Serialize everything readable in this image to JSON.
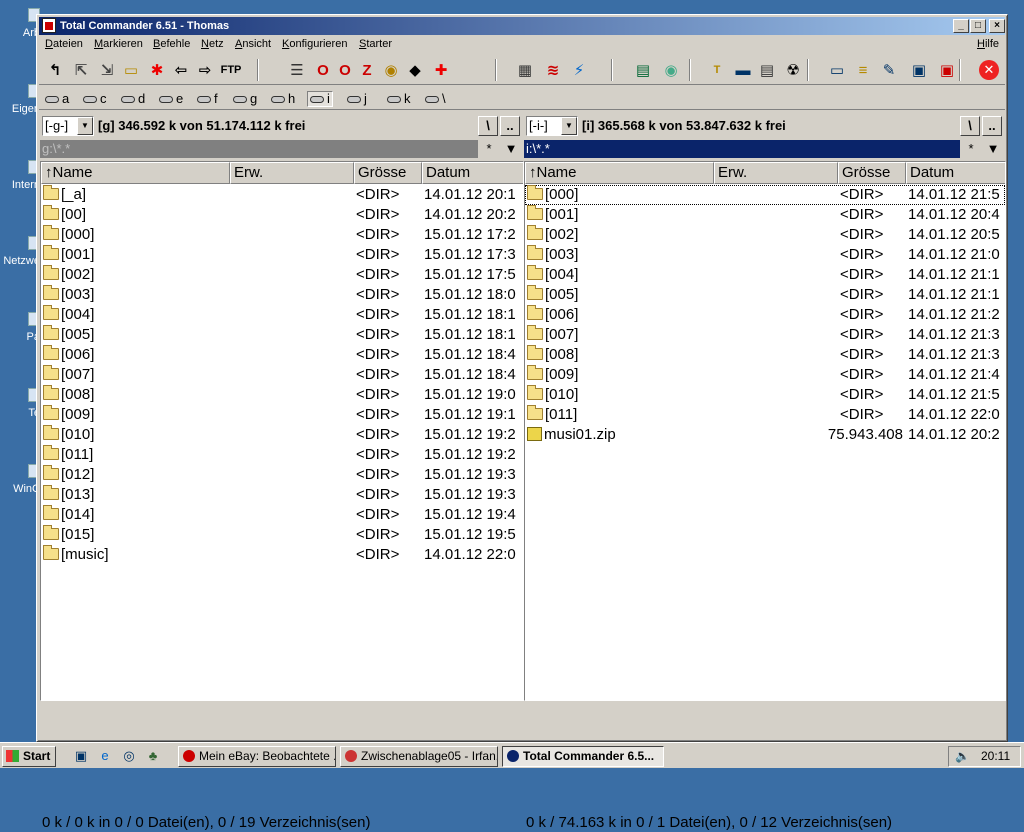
{
  "desktop": {
    "icons": [
      {
        "label": "Arb"
      },
      {
        "label": "Eigen"
      },
      {
        "label": "Intern"
      },
      {
        "label": "Netzwe"
      },
      {
        "label": "Pa"
      },
      {
        "label": "Te"
      },
      {
        "label": "WinC"
      }
    ]
  },
  "window": {
    "title": "Total Commander 6.51 - Thomas",
    "controls": {
      "minimize": "_",
      "maximize": "□",
      "close": "×"
    }
  },
  "menu": {
    "items": [
      "Dateien",
      "Markieren",
      "Befehle",
      "Netz",
      "Ansicht",
      "Konfigurieren",
      "Starter"
    ],
    "help": "Hilfe"
  },
  "toolbar": {
    "buttons": [
      {
        "name": "refresh-icon",
        "glyph": "↰",
        "color": "#000"
      },
      {
        "name": "pack-icon",
        "glyph": "⇱",
        "color": "#444"
      },
      {
        "name": "unpack-icon",
        "glyph": "⇲",
        "color": "#444"
      },
      {
        "name": "new-folder-icon",
        "glyph": "▭",
        "color": "#b58a00"
      },
      {
        "name": "select-all-icon",
        "glyph": "✱",
        "color": "#e00"
      },
      {
        "name": "back-icon",
        "glyph": "⇦",
        "color": "#000"
      },
      {
        "name": "forward-icon",
        "glyph": "⇨",
        "color": "#000"
      },
      {
        "name": "ftp-icon",
        "glyph": "FTP",
        "color": "#000"
      },
      {
        "name": "list-icon",
        "glyph": "☰",
        "color": "#333"
      },
      {
        "name": "opera-icon",
        "glyph": "O",
        "color": "#c00"
      },
      {
        "name": "opera2-icon",
        "glyph": "O",
        "color": "#c00"
      },
      {
        "name": "z-icon",
        "glyph": "Z",
        "color": "#c00"
      },
      {
        "name": "uedit-icon",
        "glyph": "◉",
        "color": "#b08000"
      },
      {
        "name": "batman-icon",
        "glyph": "◆",
        "color": "#000"
      },
      {
        "name": "swiss-icon",
        "glyph": "✚",
        "color": "#e00"
      },
      {
        "name": "chip-icon",
        "glyph": "▦",
        "color": "#333"
      },
      {
        "name": "stripes-icon",
        "glyph": "≋",
        "color": "#c00"
      },
      {
        "name": "lightning-icon",
        "glyph": "⚡",
        "color": "#06c"
      },
      {
        "name": "film-icon",
        "glyph": "▤",
        "color": "#063"
      },
      {
        "name": "eye-icon",
        "glyph": "◉",
        "color": "#4a8"
      },
      {
        "name": "tcp-icon",
        "glyph": "T",
        "color": "#b58a00"
      },
      {
        "name": "car-icon",
        "glyph": "▬",
        "color": "#036"
      },
      {
        "name": "notepad-icon",
        "glyph": "▤",
        "color": "#333"
      },
      {
        "name": "radiation-icon",
        "glyph": "☢",
        "color": "#000"
      },
      {
        "name": "computer-icon",
        "glyph": "▭",
        "color": "#036"
      },
      {
        "name": "tree-icon",
        "glyph": "≡",
        "color": "#b58a00"
      },
      {
        "name": "edit-icon",
        "glyph": "✎",
        "color": "#036"
      },
      {
        "name": "network-icon",
        "glyph": "▣",
        "color": "#036"
      },
      {
        "name": "monitor-icon",
        "glyph": "▣",
        "color": "#c00"
      },
      {
        "name": "exit-icon",
        "glyph": "✕",
        "color": "#fff"
      }
    ]
  },
  "drives": [
    {
      "letter": "a",
      "active": false
    },
    {
      "letter": "c",
      "active": false
    },
    {
      "letter": "d",
      "active": false
    },
    {
      "letter": "e",
      "active": false
    },
    {
      "letter": "f",
      "active": false
    },
    {
      "letter": "g",
      "active": false
    },
    {
      "letter": "h",
      "active": false
    },
    {
      "letter": "i",
      "active": true
    },
    {
      "letter": "j",
      "active": false
    },
    {
      "letter": "k",
      "active": false
    },
    {
      "letter": "\\",
      "active": false
    }
  ],
  "left": {
    "drive": "[-g-]",
    "info": "[g]  346.592 k von 51.174.112 k frei",
    "root_btn": "\\",
    "up_btn": "..",
    "path": "g:\\*.*",
    "star_btn": "*",
    "arrow_btn": "▼",
    "headers": {
      "name": "Name",
      "ext": "Erw.",
      "size": "Grösse",
      "date": "Datum"
    },
    "files": [
      {
        "name": "[_a]",
        "size": "<DIR>",
        "date": "14.01.12 20:1",
        "type": "dir"
      },
      {
        "name": "[00]",
        "size": "<DIR>",
        "date": "14.01.12 20:2",
        "type": "dir"
      },
      {
        "name": "[000]",
        "size": "<DIR>",
        "date": "15.01.12 17:2",
        "type": "dir"
      },
      {
        "name": "[001]",
        "size": "<DIR>",
        "date": "15.01.12 17:3",
        "type": "dir"
      },
      {
        "name": "[002]",
        "size": "<DIR>",
        "date": "15.01.12 17:5",
        "type": "dir"
      },
      {
        "name": "[003]",
        "size": "<DIR>",
        "date": "15.01.12 18:0",
        "type": "dir"
      },
      {
        "name": "[004]",
        "size": "<DIR>",
        "date": "15.01.12 18:1",
        "type": "dir"
      },
      {
        "name": "[005]",
        "size": "<DIR>",
        "date": "15.01.12 18:1",
        "type": "dir"
      },
      {
        "name": "[006]",
        "size": "<DIR>",
        "date": "15.01.12 18:4",
        "type": "dir"
      },
      {
        "name": "[007]",
        "size": "<DIR>",
        "date": "15.01.12 18:4",
        "type": "dir"
      },
      {
        "name": "[008]",
        "size": "<DIR>",
        "date": "15.01.12 19:0",
        "type": "dir"
      },
      {
        "name": "[009]",
        "size": "<DIR>",
        "date": "15.01.12 19:1",
        "type": "dir"
      },
      {
        "name": "[010]",
        "size": "<DIR>",
        "date": "15.01.12 19:2",
        "type": "dir"
      },
      {
        "name": "[011]",
        "size": "<DIR>",
        "date": "15.01.12 19:2",
        "type": "dir"
      },
      {
        "name": "[012]",
        "size": "<DIR>",
        "date": "15.01.12 19:3",
        "type": "dir"
      },
      {
        "name": "[013]",
        "size": "<DIR>",
        "date": "15.01.12 19:3",
        "type": "dir"
      },
      {
        "name": "[014]",
        "size": "<DIR>",
        "date": "15.01.12 19:4",
        "type": "dir"
      },
      {
        "name": "[015]",
        "size": "<DIR>",
        "date": "15.01.12 19:5",
        "type": "dir"
      },
      {
        "name": "[music]",
        "size": "<DIR>",
        "date": "14.01.12 22:0",
        "type": "dir"
      }
    ],
    "status": "0 k / 0 k in 0 / 0 Datei(en), 0 / 19 Verzeichnis(sen)"
  },
  "right": {
    "drive": "[-i-]",
    "info": "[i]  365.568 k von 53.847.632 k frei",
    "root_btn": "\\",
    "up_btn": "..",
    "path": "i:\\*.*",
    "star_btn": "*",
    "arrow_btn": "▼",
    "headers": {
      "name": "Name",
      "ext": "Erw.",
      "size": "Grösse",
      "date": "Datum"
    },
    "files": [
      {
        "name": "[000]",
        "size": "<DIR>",
        "date": "14.01.12 21:5",
        "type": "dir"
      },
      {
        "name": "[001]",
        "size": "<DIR>",
        "date": "14.01.12 20:4",
        "type": "dir"
      },
      {
        "name": "[002]",
        "size": "<DIR>",
        "date": "14.01.12 20:5",
        "type": "dir"
      },
      {
        "name": "[003]",
        "size": "<DIR>",
        "date": "14.01.12 21:0",
        "type": "dir"
      },
      {
        "name": "[004]",
        "size": "<DIR>",
        "date": "14.01.12 21:1",
        "type": "dir"
      },
      {
        "name": "[005]",
        "size": "<DIR>",
        "date": "14.01.12 21:1",
        "type": "dir"
      },
      {
        "name": "[006]",
        "size": "<DIR>",
        "date": "14.01.12 21:2",
        "type": "dir"
      },
      {
        "name": "[007]",
        "size": "<DIR>",
        "date": "14.01.12 21:3",
        "type": "dir"
      },
      {
        "name": "[008]",
        "size": "<DIR>",
        "date": "14.01.12 21:3",
        "type": "dir"
      },
      {
        "name": "[009]",
        "size": "<DIR>",
        "date": "14.01.12 21:4",
        "type": "dir"
      },
      {
        "name": "[010]",
        "size": "<DIR>",
        "date": "14.01.12 21:5",
        "type": "dir"
      },
      {
        "name": "[011]",
        "size": "<DIR>",
        "date": "14.01.12 22:0",
        "type": "dir"
      },
      {
        "name": "musi01.zip",
        "size": "75.943.408",
        "date": "14.01.12 20:2",
        "type": "zip"
      }
    ],
    "status": "0 k / 74.163 k in 0 / 1 Datei(en), 0 / 12 Verzeichnis(sen)"
  },
  "taskbar": {
    "start": "Start",
    "quicklaunch": [
      {
        "name": "desktop-icon",
        "glyph": "▣",
        "color": "#036"
      },
      {
        "name": "ie-icon",
        "glyph": "e",
        "color": "#06c"
      },
      {
        "name": "network-icon",
        "glyph": "◎",
        "color": "#036"
      },
      {
        "name": "app-icon",
        "glyph": "♣",
        "color": "#363"
      }
    ],
    "tasks": [
      {
        "label": "Mein eBay: Beobachtete ...",
        "icon_color": "#c00",
        "active": false
      },
      {
        "label": "Zwischenablage05 - Irfan...",
        "icon_color": "#c33",
        "active": false
      },
      {
        "label": "Total Commander 6.5...",
        "icon_color": "#0a246a",
        "active": true
      }
    ],
    "clock": "20:11",
    "speaker": "🔈"
  }
}
